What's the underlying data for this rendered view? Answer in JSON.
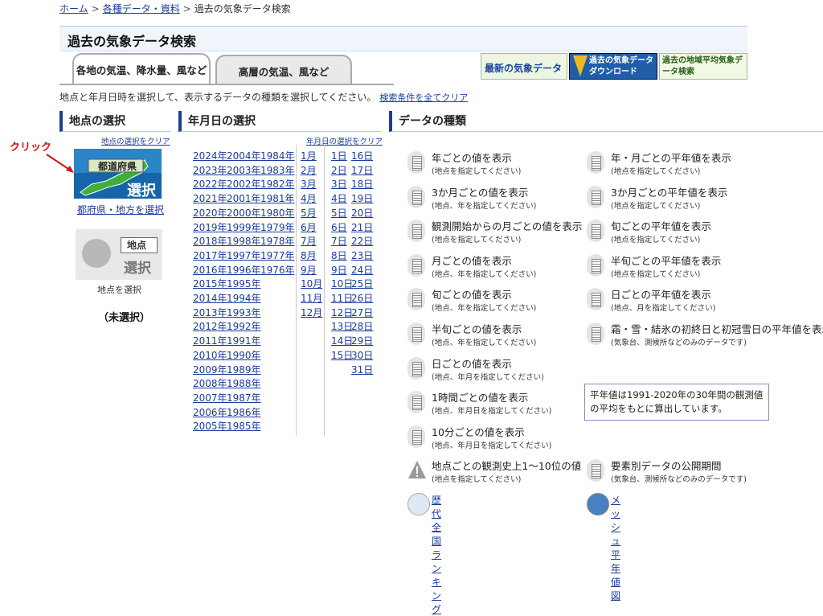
{
  "breadcrumb": [
    "ホーム",
    "各種データ・資料",
    "過去の気象データ検索"
  ],
  "page_title": "過去の気象データ検索",
  "tabs": [
    "各地の気温、降水量、風など",
    "高層の気温、風など"
  ],
  "banners": [
    "最新の気象データ",
    "過去の気象データ ダウンロード",
    "過去の地域平均気象データ検索"
  ],
  "instruction": "地点と年月日時を選択して、表示するデータの種類を選択してください。",
  "clear_all": "検索条件を全てクリア",
  "sections": {
    "location": "地点の選択",
    "date": "年月日の選択",
    "datatype": "データの種類"
  },
  "location": {
    "clear": "地点の選択をクリア",
    "annotation": "クリック",
    "pref_button_top": "都道府県",
    "pref_button_bottom": "選択",
    "pref_link": "都府県・地方を選択",
    "point_button_top": "地点",
    "point_button_bottom": "選択",
    "point_caption": "地点を選択",
    "status": "（未選択）"
  },
  "date": {
    "clear": "年月日の選択をクリア",
    "years_col1": [
      "2024年",
      "2023年",
      "2022年",
      "2021年",
      "2020年",
      "2019年",
      "2018年",
      "2017年",
      "2016年",
      "2015年",
      "2014年",
      "2013年",
      "2012年",
      "2011年",
      "2010年",
      "2009年",
      "2008年",
      "2007年",
      "2006年",
      "2005年"
    ],
    "years_col2": [
      "2004年",
      "2003年",
      "2002年",
      "2001年",
      "2000年",
      "1999年",
      "1998年",
      "1997年",
      "1996年",
      "1995年",
      "1994年",
      "1993年",
      "1992年",
      "1991年",
      "1990年",
      "1989年",
      "1988年",
      "1987年",
      "1986年",
      "1985年"
    ],
    "years_col3": [
      "1984年",
      "1983年",
      "1982年",
      "1981年",
      "1980年",
      "1979年",
      "1978年",
      "1977年",
      "1976年"
    ],
    "months": [
      "1月",
      "2月",
      "3月",
      "4月",
      "5月",
      "6月",
      "7月",
      "8月",
      "9月",
      "10月",
      "11月",
      "12月"
    ],
    "days_col1": [
      "1日",
      "2日",
      "3日",
      "4日",
      "5日",
      "6日",
      "7日",
      "8日",
      "9日",
      "10日",
      "11日",
      "12日",
      "13日",
      "14日",
      "15日"
    ],
    "days_col2": [
      "16日",
      "17日",
      "18日",
      "19日",
      "20日",
      "21日",
      "22日",
      "23日",
      "24日",
      "25日",
      "26日",
      "27日",
      "28日",
      "29日",
      "30日",
      "31日"
    ]
  },
  "datatypes_left": [
    {
      "label": "年ごとの値を表示",
      "sub": "(地点を指定してください)"
    },
    {
      "label": "3か月ごとの値を表示",
      "sub": "(地点、年を指定してください)"
    },
    {
      "label": "観測開始からの月ごとの値を表示",
      "sub": "(地点を指定してください)"
    },
    {
      "label": "月ごとの値を表示",
      "sub": "(地点、年を指定してください)"
    },
    {
      "label": "旬ごとの値を表示",
      "sub": "(地点、年を指定してください)"
    },
    {
      "label": "半旬ごとの値を表示",
      "sub": "(地点、年を指定してください)"
    },
    {
      "label": "日ごとの値を表示",
      "sub": "(地点、年月を指定してください)"
    },
    {
      "label": "1時間ごとの値を表示",
      "sub": "(地点、年月日を指定してください)"
    },
    {
      "label": "10分ごとの値を表示",
      "sub": "(地点、年月日を指定してください)"
    },
    {
      "label": "地点ごとの観測史上1～10位の値",
      "sub": "(地点を指定してください)"
    }
  ],
  "datatypes_right": [
    {
      "label": "年・月ごとの平年値を表示",
      "sub": "(地点を指定してください)"
    },
    {
      "label": "3か月ごとの平年値を表示",
      "sub": "(地点を指定してください)"
    },
    {
      "label": "旬ごとの平年値を表示",
      "sub": "(地点を指定してください)"
    },
    {
      "label": "半旬ごとの平年値を表示",
      "sub": "(地点を指定してください)"
    },
    {
      "label": "日ごとの平年値を表示",
      "sub": "(地点、月を指定してください)"
    },
    {
      "label": "霜・雪・結氷の初終日と初冠雪日の平年値を表示",
      "sub": "(気象台、測候所などのみのデータです)"
    }
  ],
  "note": "平年値は1991-2020年の30年間の観測値の平均をもとに算出しています。",
  "element_period": {
    "label": "要素別データの公開期間",
    "sub": "(気象台、測候所などのみのデータです)"
  },
  "ranking_link": "歴代全国ランキング",
  "mesh_link": "メッシュ平年値図"
}
